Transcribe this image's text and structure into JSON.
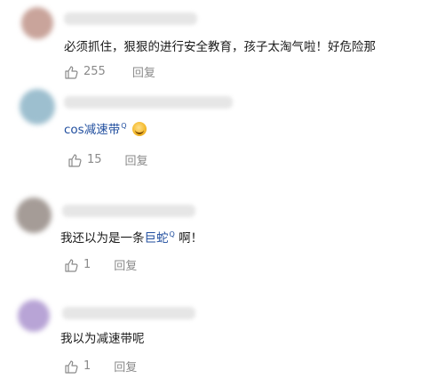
{
  "comments": [
    {
      "text_parts": [
        {
          "text": "必须抓住，狠狠的进行安全教育，孩子太淘气啦！好危险那",
          "link": false
        }
      ],
      "likes": "255",
      "reply_label": "回复",
      "avatar_color": "#c9a49b"
    },
    {
      "text_parts": [
        {
          "text": "cos减速带",
          "link": true
        }
      ],
      "emoji": "grin-emoji",
      "likes": "15",
      "reply_label": "回复",
      "avatar_color": "#9dbfcf"
    },
    {
      "text_parts": [
        {
          "text": "我还以为是一条",
          "link": false
        },
        {
          "text": "巨蛇",
          "link": true
        },
        {
          "text": "啊！",
          "link": false
        }
      ],
      "likes": "1",
      "reply_label": "回复",
      "avatar_color": "#a59c97"
    },
    {
      "text_parts": [
        {
          "text": "我以为减速带呢",
          "link": false
        }
      ],
      "likes": "1",
      "reply_label": "回复",
      "avatar_color": "#b8a4d6"
    }
  ],
  "search_mark": "Q",
  "icons": {
    "like": "thumbs-up-icon",
    "search": "search-icon"
  }
}
